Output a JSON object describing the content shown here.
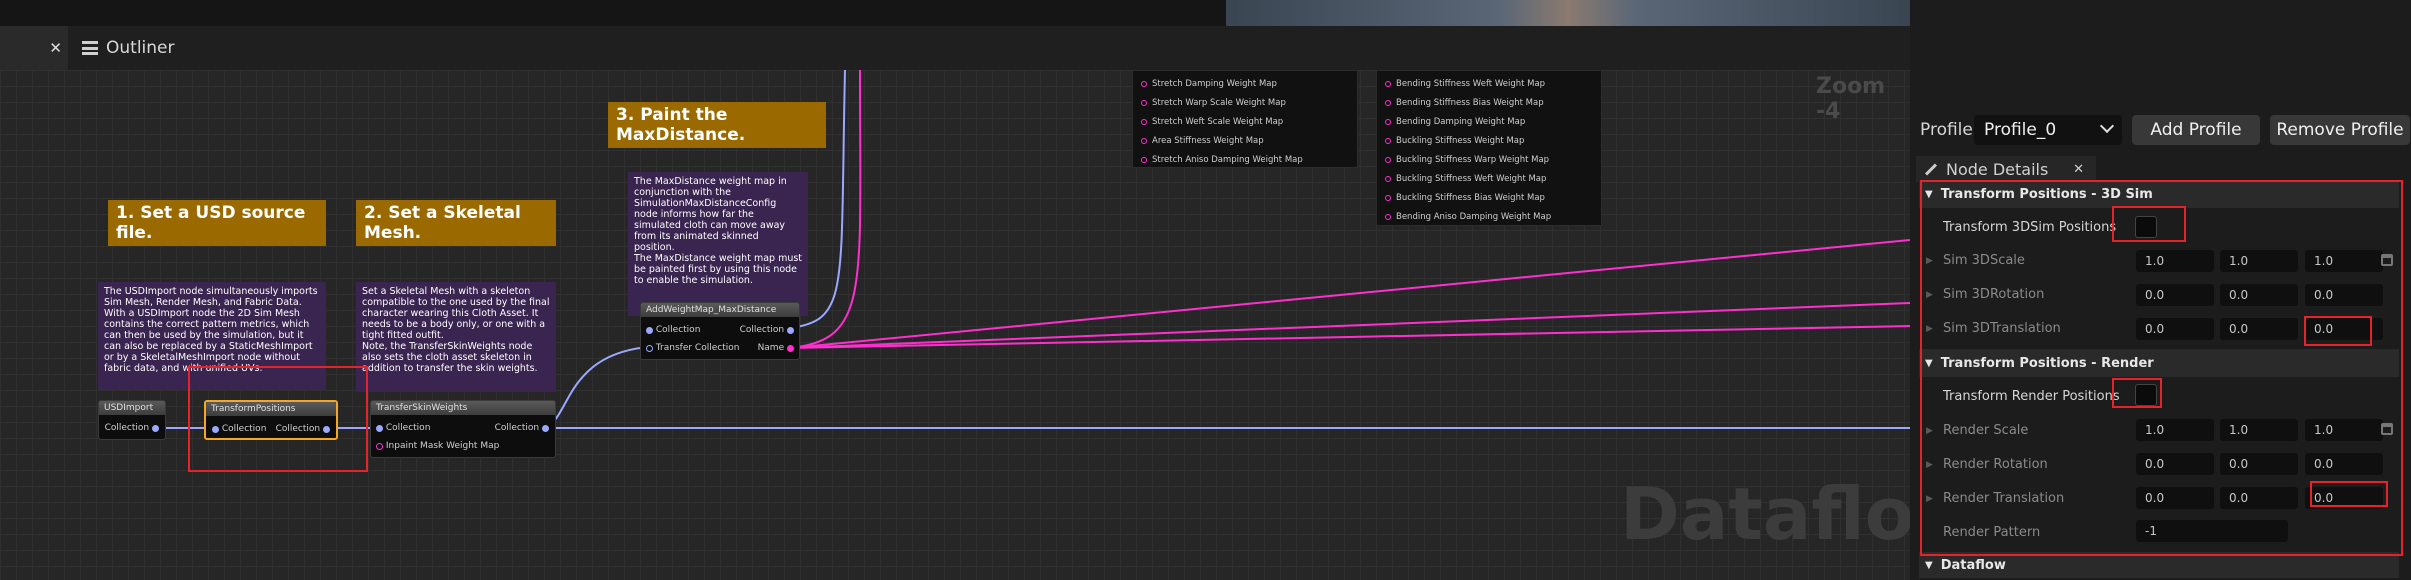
{
  "tabs": {
    "close_glyph": "✕",
    "outliner": "Outliner"
  },
  "graph": {
    "zoom": "Zoom -4",
    "watermark": "Dataflow",
    "comments": [
      {
        "title": "1. Set a USD source file.",
        "body": "The USDImport node simultaneously imports Sim Mesh, Render Mesh, and Fabric Data.\nWith a USDImport node the 2D Sim Mesh contains the correct pattern metrics, which can then be used by the simulation, but it can also be replaced by a StaticMeshImport or by a SkeletalMeshImport node without fabric data, and with unified UVs."
      },
      {
        "title": "2. Set a Skeletal Mesh.",
        "body": "Set a Skeletal Mesh with a skeleton compatible to the one used by the final character wearing this Cloth Asset. It needs to be a body only, or one with a tight fitted outfit.\nNote, the TransferSkinWeights node also sets the cloth asset skeleton in addition to transfer the skin weights."
      },
      {
        "title": "3. Paint the MaxDistance.",
        "body": "The MaxDistance weight map in conjunction with the SimulationMaxDistanceConfig node informs how far the simulated cloth can move away from its animated skinned position.\nThe MaxDistance weight map must be painted first by using this node to enable the simulation."
      }
    ],
    "nodes": {
      "usd": {
        "title": "USDImport",
        "out": "Collection"
      },
      "transform": {
        "title": "TransformPositions",
        "in": "Collection",
        "out": "Collection"
      },
      "transfer": {
        "title": "TransferSkinWeights",
        "in": "Collection",
        "out": "Collection",
        "extra": "Inpaint Mask Weight Map"
      },
      "addweight": {
        "title": "AddWeightMap_MaxDistance",
        "in1": "Collection",
        "out1": "Collection",
        "in2": "Transfer Collection",
        "out2": "Name"
      }
    },
    "weightmaps_left": [
      "Stretch Damping Weight Map",
      "Stretch Warp Scale Weight Map",
      "Stretch Weft Scale Weight Map",
      "Area Stiffness Weight Map",
      "Stretch Aniso Damping Weight Map"
    ],
    "weightmaps_right": [
      "Bending Stiffness Weft Weight Map",
      "Bending Stiffness Bias Weight Map",
      "Bending Damping Weight Map",
      "Buckling Stiffness Weight Map",
      "Buckling Stiffness Warp Weight Map",
      "Buckling Stiffness Weft Weight Map",
      "Buckling Stiffness Bias Weight Map",
      "Bending Aniso Damping Weight Map"
    ]
  },
  "details": {
    "profile_label": "Profile",
    "profile_value": "Profile_0",
    "add_profile": "Add Profile",
    "remove_profile": "Remove Profile",
    "panel_title": "Node Details",
    "close_glyph": "✕",
    "sections": {
      "sim": {
        "title": "Transform Positions - 3D Sim",
        "toggle_label": "Transform 3DSim Positions",
        "scale": {
          "label": "Sim 3DScale",
          "values": [
            "1.0",
            "1.0",
            "1.0"
          ]
        },
        "rotation": {
          "label": "Sim 3DRotation",
          "values": [
            "0.0",
            "0.0",
            "0.0"
          ]
        },
        "translation": {
          "label": "Sim 3DTranslation",
          "values": [
            "0.0",
            "0.0",
            "0.0"
          ]
        }
      },
      "render": {
        "title": "Transform Positions - Render",
        "toggle_label": "Transform Render Positions",
        "scale": {
          "label": "Render Scale",
          "values": [
            "1.0",
            "1.0",
            "1.0"
          ]
        },
        "rotation": {
          "label": "Render Rotation",
          "values": [
            "0.0",
            "0.0",
            "0.0"
          ]
        },
        "translation": {
          "label": "Render Translation",
          "values": [
            "0.0",
            "0.0",
            "0.0"
          ]
        },
        "pattern": {
          "label": "Render Pattern",
          "value": "-1"
        }
      },
      "dataflow": {
        "title": "Dataflow"
      }
    }
  },
  "colors": {
    "highlight": "#e4232b",
    "comment_gold": "#9a6a00",
    "comment_purple": "#3a2450",
    "wire_blue": "#9aa8ff",
    "wire_pink": "#ff2fcf"
  }
}
